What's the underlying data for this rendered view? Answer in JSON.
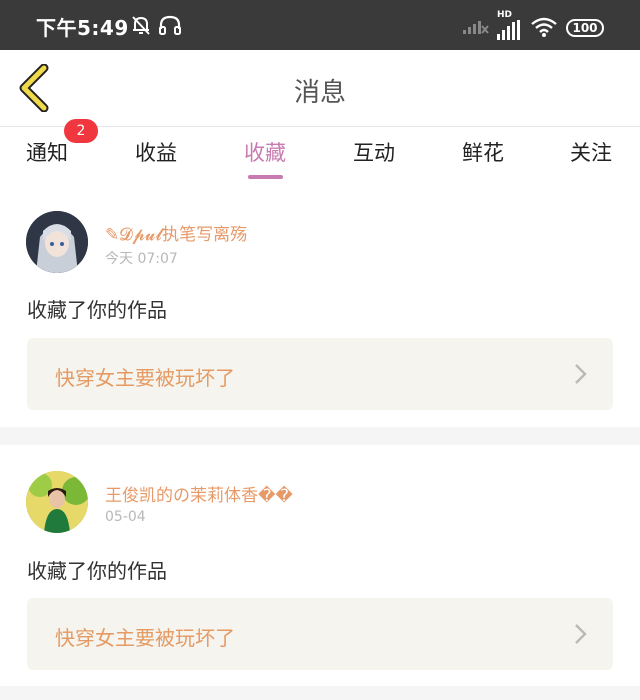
{
  "status_bar": {
    "time": "下午5:49",
    "network_type": "HD",
    "battery": "100",
    "icons": [
      "bell-muted-icon",
      "headset-icon",
      "signal-icon",
      "wifi-icon",
      "battery-icon"
    ]
  },
  "header": {
    "title": "消息",
    "back_icon": "chevron-left-icon",
    "accent_color": "#f0d94a"
  },
  "tabs": {
    "items": [
      {
        "label": "通知",
        "badge": "2"
      },
      {
        "label": "收益"
      },
      {
        "label": "收藏",
        "active": true
      },
      {
        "label": "互动"
      },
      {
        "label": "鲜花"
      },
      {
        "label": "关注"
      }
    ],
    "active_color": "#c87bb0"
  },
  "messages": [
    {
      "username": "✎𝓓𝓹𝓾𝓵执笔写离殇",
      "time": "今天 07:07",
      "action": "收藏了你的作品",
      "work_title": "快穿女主要被玩坏了"
    },
    {
      "username": "王俊凯的の茉莉体香��",
      "time": "05-04",
      "action": "收藏了你的作品",
      "work_title": "快穿女主要被玩坏了"
    }
  ]
}
